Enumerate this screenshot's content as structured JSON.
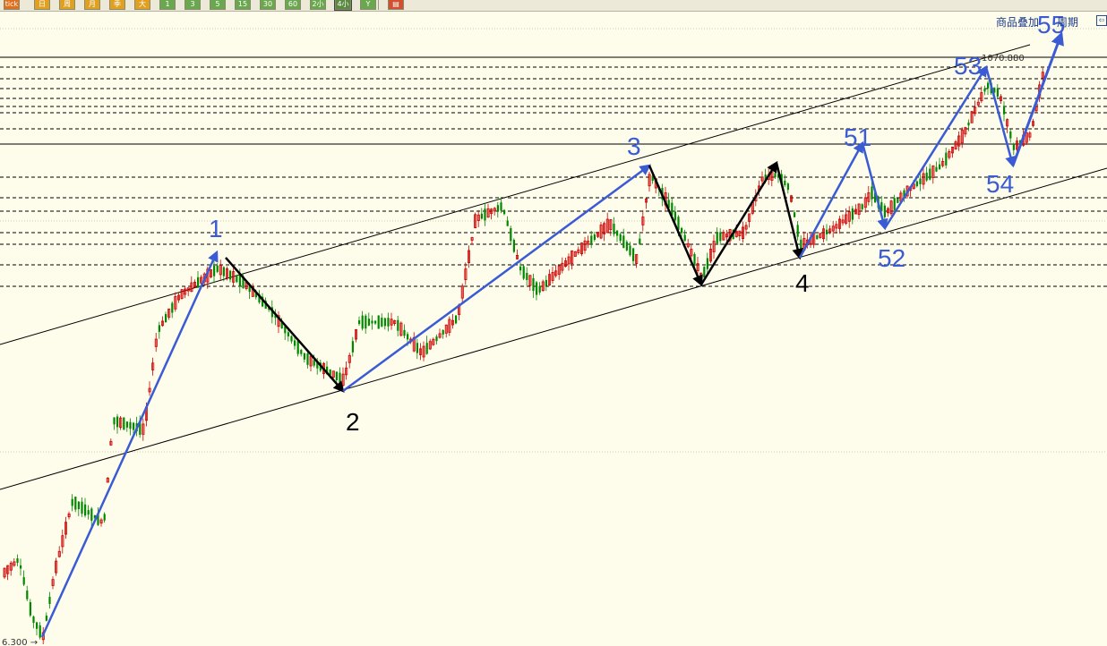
{
  "toolbar": {
    "buttons": [
      {
        "label": "tick",
        "color": "#e07020"
      },
      {
        "label": "日",
        "color": "#e0a020"
      },
      {
        "label": "周",
        "color": "#e0a020"
      },
      {
        "label": "月",
        "color": "#e0a020"
      },
      {
        "label": "季",
        "color": "#e0a020"
      },
      {
        "label": "大",
        "color": "#e0a020"
      },
      {
        "label": "1",
        "color": "#6aa84f"
      },
      {
        "label": "3",
        "color": "#6aa84f"
      },
      {
        "label": "5",
        "color": "#6aa84f"
      },
      {
        "label": "15",
        "color": "#6aa84f"
      },
      {
        "label": "30",
        "color": "#6aa84f"
      },
      {
        "label": "60",
        "color": "#6aa84f"
      },
      {
        "label": "2小",
        "color": "#6aa84f"
      },
      {
        "label": "4小",
        "color": "#6aa84f",
        "active": true
      },
      {
        "label": "Y",
        "color": "#6aa84f"
      },
      {
        "label": "▤",
        "color": "#d05030"
      }
    ]
  },
  "header_links": {
    "overlay": "商品叠加",
    "period": "周期"
  },
  "corner_icon": "panel-icon",
  "chart_data": {
    "type": "candlestick",
    "colors": {
      "up": "#cc0000",
      "down": "#008800",
      "impulse": "#3a5bd4",
      "correction": "#000000",
      "channel": "#000000",
      "background": "#fefcea"
    },
    "price_labels": {
      "high": "1070.880",
      "low": "6.300"
    },
    "wave_labels": [
      {
        "text": "1",
        "color": "#3a5bd4"
      },
      {
        "text": "2",
        "color": "#000000"
      },
      {
        "text": "3",
        "color": "#3a5bd4"
      },
      {
        "text": "4",
        "color": "#000000"
      },
      {
        "text": "51",
        "color": "#3a5bd4"
      },
      {
        "text": "52",
        "color": "#3a5bd4"
      },
      {
        "text": "53",
        "color": "#3a5bd4"
      },
      {
        "text": "54",
        "color": "#3a5bd4"
      },
      {
        "text": "55",
        "color": "#3a5bd4"
      }
    ],
    "waves": [
      {
        "from": [
          47,
          712
        ],
        "to": [
          242,
          282
        ],
        "color": "#3a5bd4",
        "width": 2.5
      },
      {
        "from": [
          252,
          288
        ],
        "to": [
          383,
          437
        ],
        "color": "#000000",
        "width": 2.5
      },
      {
        "from": [
          383,
          437
        ],
        "to": [
          725,
          185
        ],
        "color": "#3a5bd4",
        "width": 2.5
      },
      {
        "from": [
          725,
          185
        ],
        "to": [
          783,
          318
        ],
        "color": "#000000",
        "width": 2.5
      },
      {
        "from": [
          783,
          318
        ],
        "to": [
          867,
          182
        ],
        "color": "#000000",
        "width": 2.5
      },
      {
        "from": [
          867,
          182
        ],
        "to": [
          893,
          288
        ],
        "color": "#000000",
        "width": 2.5
      },
      {
        "from": [
          893,
          288
        ],
        "to": [
          963,
          160
        ],
        "color": "#3a5bd4",
        "width": 2.5
      },
      {
        "from": [
          963,
          160
        ],
        "to": [
          988,
          255
        ],
        "color": "#3a5bd4",
        "width": 2.5
      },
      {
        "from": [
          988,
          255
        ],
        "to": [
          1101,
          75
        ],
        "color": "#3a5bd4",
        "width": 2.5
      },
      {
        "from": [
          1101,
          75
        ],
        "to": [
          1131,
          185
        ],
        "color": "#3a5bd4",
        "width": 2.5
      },
      {
        "from": [
          1131,
          185
        ],
        "to": [
          1185,
          38
        ],
        "color": "#3a5bd4",
        "width": 3
      }
    ],
    "channels": [
      {
        "from": [
          0,
          385
        ],
        "to": [
          1150,
          50
        ]
      },
      {
        "from": [
          0,
          547
        ],
        "to": [
          1236,
          188
        ]
      }
    ],
    "solid_hlines": [
      64,
      161
    ],
    "dashed_hlines": [
      75,
      88,
      99,
      110,
      119,
      126,
      144,
      198,
      221,
      236,
      260,
      273,
      296,
      320
    ],
    "dotted_hlines": [
      32,
      247,
      505
    ]
  }
}
